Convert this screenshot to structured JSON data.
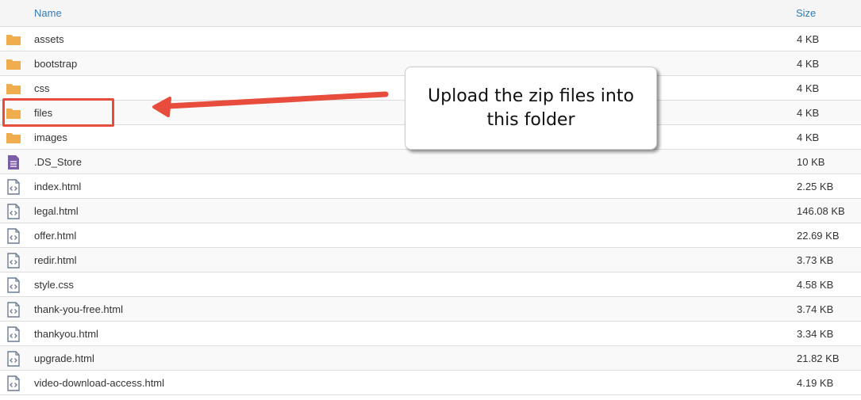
{
  "header": {
    "name_label": "Name",
    "size_label": "Size"
  },
  "rows": [
    {
      "name": "assets",
      "size": "4 KB",
      "type": "folder"
    },
    {
      "name": "bootstrap",
      "size": "4 KB",
      "type": "folder"
    },
    {
      "name": "css",
      "size": "4 KB",
      "type": "folder"
    },
    {
      "name": "files",
      "size": "4 KB",
      "type": "folder"
    },
    {
      "name": "images",
      "size": "4 KB",
      "type": "folder"
    },
    {
      "name": ".DS_Store",
      "size": "10 KB",
      "type": "text-file"
    },
    {
      "name": "index.html",
      "size": "2.25 KB",
      "type": "code-file"
    },
    {
      "name": "legal.html",
      "size": "146.08 KB",
      "type": "code-file"
    },
    {
      "name": "offer.html",
      "size": "22.69 KB",
      "type": "code-file"
    },
    {
      "name": "redir.html",
      "size": "3.73 KB",
      "type": "code-file"
    },
    {
      "name": "style.css",
      "size": "4.58 KB",
      "type": "code-file"
    },
    {
      "name": "thank-you-free.html",
      "size": "3.74 KB",
      "type": "code-file"
    },
    {
      "name": "thankyou.html",
      "size": "3.34 KB",
      "type": "code-file"
    },
    {
      "name": "upgrade.html",
      "size": "21.82 KB",
      "type": "code-file"
    },
    {
      "name": "video-download-access.html",
      "size": "4.19 KB",
      "type": "code-file"
    }
  ],
  "callout": {
    "text": "Upload the zip files into this folder"
  },
  "colors": {
    "folder": "#f0ad4e",
    "text_file": "#7b5ea7",
    "code_file": "#6b7c93",
    "link": "#337ab7",
    "annotation": "#e74c3c"
  }
}
